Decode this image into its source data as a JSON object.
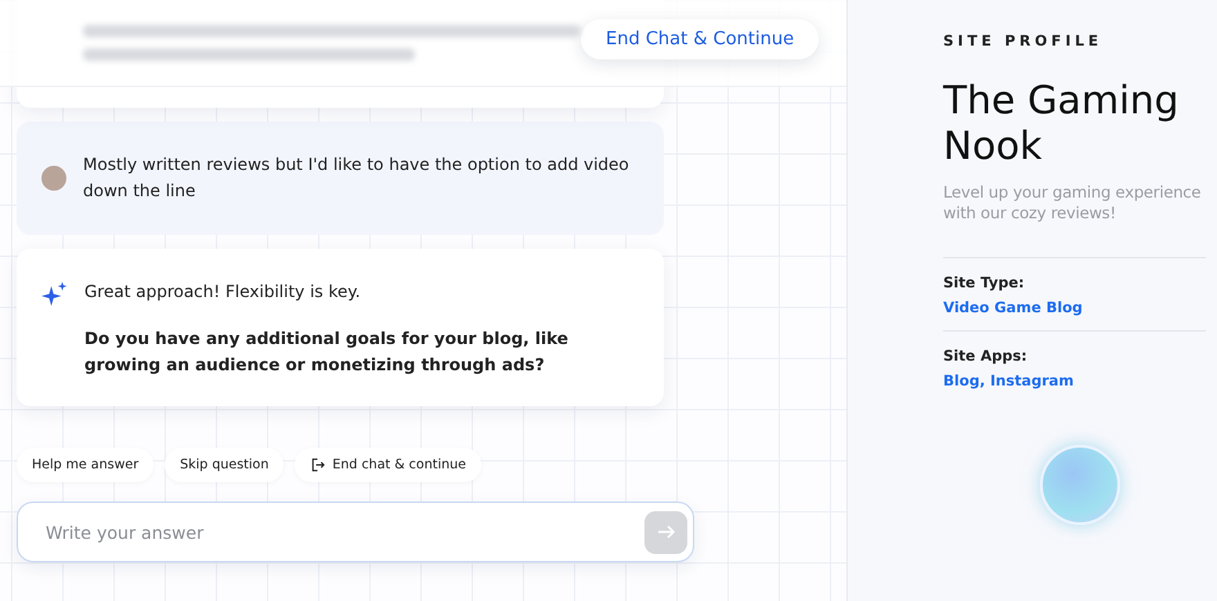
{
  "header": {
    "end_button": "End Chat & Continue"
  },
  "messages": [
    {
      "kind": "user",
      "text": "Mostly written reviews but I'd like to have the option to add video down the line"
    },
    {
      "kind": "assistant",
      "text": "Great approach! Flexibility is key.",
      "question": "Do you have any additional goals for your blog, like growing an audience or monetizing through ads?"
    }
  ],
  "chips": [
    {
      "label": "Help me answer",
      "kind": "plain"
    },
    {
      "label": "Skip question",
      "kind": "plain"
    },
    {
      "label": "End chat & continue",
      "kind": "exit"
    }
  ],
  "input": {
    "placeholder": "Write your answer"
  },
  "profile": {
    "heading": "SITE PROFILE",
    "name": "The Gaming Nook",
    "tagline": "Level up your gaming experience with our cozy reviews!",
    "fields": [
      {
        "label": "Site Type:",
        "value": "Video Game Blog"
      },
      {
        "label": "Site Apps:",
        "value": "Blog, Instagram"
      }
    ]
  }
}
